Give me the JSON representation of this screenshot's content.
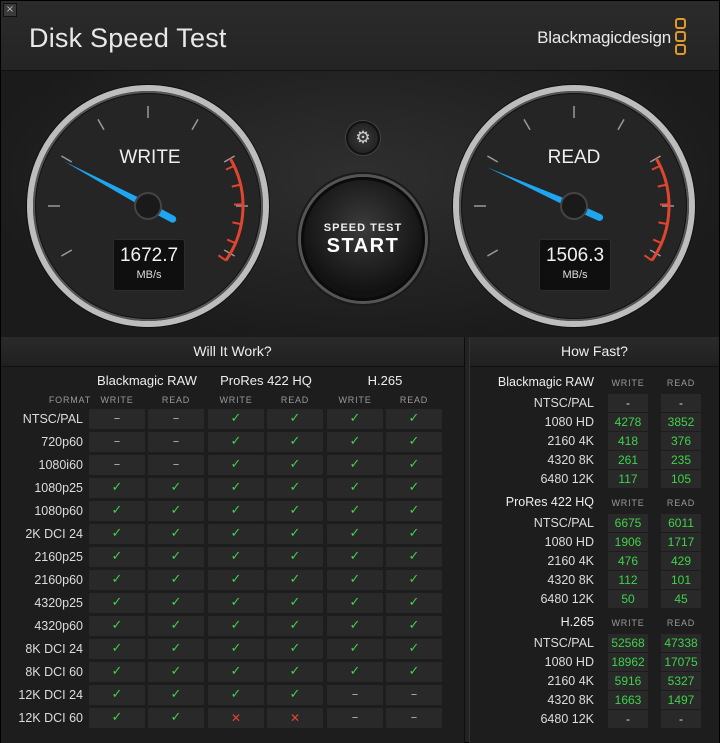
{
  "app": {
    "title": "Disk Speed Test",
    "brand": "Blackmagicdesign",
    "close_glyph": "×"
  },
  "gauges": {
    "write": {
      "label": "WRITE",
      "value": "1672.7",
      "unit": "MB/s"
    },
    "read": {
      "label": "READ",
      "value": "1506.3",
      "unit": "MB/s"
    }
  },
  "controls": {
    "settings_icon": "gear-icon",
    "settings_glyph": "⚙",
    "start_line1": "SPEED TEST",
    "start_line2": "START"
  },
  "will_it_work": {
    "title": "Will It Work?",
    "format_header": "FORMAT",
    "codecs": [
      "Blackmagic RAW",
      "ProRes 422 HQ",
      "H.265"
    ],
    "col_write": "WRITE",
    "col_read": "READ",
    "rows": [
      {
        "format": "NTSC/PAL",
        "c": [
          "dash",
          "dash",
          "ok",
          "ok",
          "ok",
          "ok"
        ]
      },
      {
        "format": "720p60",
        "c": [
          "dash",
          "dash",
          "ok",
          "ok",
          "ok",
          "ok"
        ]
      },
      {
        "format": "1080i60",
        "c": [
          "dash",
          "dash",
          "ok",
          "ok",
          "ok",
          "ok"
        ]
      },
      {
        "format": "1080p25",
        "c": [
          "ok",
          "ok",
          "ok",
          "ok",
          "ok",
          "ok"
        ]
      },
      {
        "format": "1080p60",
        "c": [
          "ok",
          "ok",
          "ok",
          "ok",
          "ok",
          "ok"
        ]
      },
      {
        "format": "2K DCI 24",
        "c": [
          "ok",
          "ok",
          "ok",
          "ok",
          "ok",
          "ok"
        ]
      },
      {
        "format": "2160p25",
        "c": [
          "ok",
          "ok",
          "ok",
          "ok",
          "ok",
          "ok"
        ]
      },
      {
        "format": "2160p60",
        "c": [
          "ok",
          "ok",
          "ok",
          "ok",
          "ok",
          "ok"
        ]
      },
      {
        "format": "4320p25",
        "c": [
          "ok",
          "ok",
          "ok",
          "ok",
          "ok",
          "ok"
        ]
      },
      {
        "format": "4320p60",
        "c": [
          "ok",
          "ok",
          "ok",
          "ok",
          "ok",
          "ok"
        ]
      },
      {
        "format": "8K DCI 24",
        "c": [
          "ok",
          "ok",
          "ok",
          "ok",
          "ok",
          "ok"
        ]
      },
      {
        "format": "8K DCI 60",
        "c": [
          "ok",
          "ok",
          "ok",
          "ok",
          "ok",
          "ok"
        ]
      },
      {
        "format": "12K DCI 24",
        "c": [
          "ok",
          "ok",
          "ok",
          "ok",
          "dash",
          "dash"
        ]
      },
      {
        "format": "12K DCI 60",
        "c": [
          "ok",
          "ok",
          "no",
          "no",
          "dash",
          "dash"
        ]
      }
    ],
    "glyphs": {
      "ok": "✓",
      "dash": "–",
      "no": "✕"
    }
  },
  "how_fast": {
    "title": "How Fast?",
    "col_write": "WRITE",
    "col_read": "READ",
    "groups": [
      {
        "name": "Blackmagic RAW",
        "rows": [
          {
            "label": "NTSC/PAL",
            "write": "-",
            "read": "-"
          },
          {
            "label": "1080 HD",
            "write": "4278",
            "read": "3852"
          },
          {
            "label": "2160 4K",
            "write": "418",
            "read": "376"
          },
          {
            "label": "4320 8K",
            "write": "261",
            "read": "235"
          },
          {
            "label": "6480 12K",
            "write": "117",
            "read": "105"
          }
        ]
      },
      {
        "name": "ProRes 422 HQ",
        "rows": [
          {
            "label": "NTSC/PAL",
            "write": "6675",
            "read": "6011"
          },
          {
            "label": "1080 HD",
            "write": "1906",
            "read": "1717"
          },
          {
            "label": "2160 4K",
            "write": "476",
            "read": "429"
          },
          {
            "label": "4320 8K",
            "write": "112",
            "read": "101"
          },
          {
            "label": "6480 12K",
            "write": "50",
            "read": "45"
          }
        ]
      },
      {
        "name": "H.265",
        "rows": [
          {
            "label": "NTSC/PAL",
            "write": "52568",
            "read": "47338"
          },
          {
            "label": "1080 HD",
            "write": "18962",
            "read": "17075"
          },
          {
            "label": "2160 4K",
            "write": "5916",
            "read": "5327"
          },
          {
            "label": "4320 8K",
            "write": "1663",
            "read": "1497"
          },
          {
            "label": "6480 12K",
            "write": "-",
            "read": "-"
          }
        ]
      }
    ]
  },
  "colors": {
    "accent": "#1ea6f0",
    "ok": "#3fd24a",
    "bad": "#e0452f",
    "redzone": "#e0452f",
    "logo": "#e09a2b"
  }
}
